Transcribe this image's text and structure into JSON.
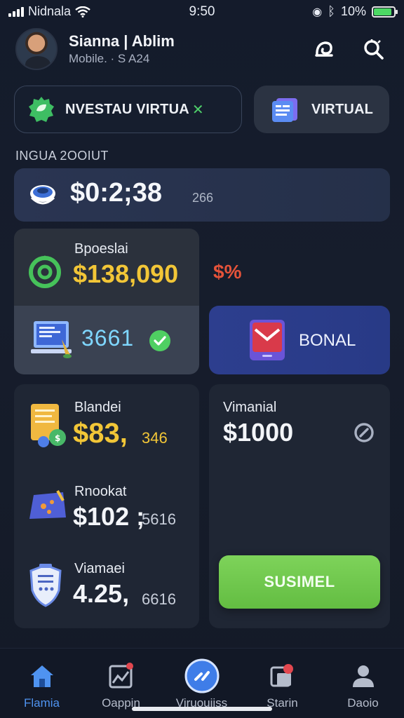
{
  "status": {
    "carrier": "Nidnala",
    "time": "9:50",
    "battery_percent": "10%",
    "battery_level": 0.9
  },
  "header": {
    "user_name": "Sianna | Ablim",
    "user_subtitle": "Mobile. · S A24"
  },
  "chips": {
    "invest_label": "NVESTAU VIRTUA",
    "virtual_label": "VIRTUAL"
  },
  "section_title": "INGUA 2OOIUT",
  "balance": {
    "value": "$0:2;38",
    "sub": "266"
  },
  "cards": {
    "personal": {
      "label": "Bpoeslai",
      "value": "$138,090",
      "change": "$%"
    },
    "virtual_box": {
      "value": "3661"
    },
    "bonal": {
      "label": "BONAL"
    },
    "blandei": {
      "label": "Blandei",
      "value": "$83,",
      "side": "346"
    },
    "rnookat": {
      "label": "Rnookat",
      "value": "$102 ;",
      "side": "5616"
    },
    "viamaei": {
      "label": "Viamaei",
      "value": "4.25,",
      "side": "6616"
    },
    "vimanial": {
      "label": "Vimanial",
      "value": "$1000"
    }
  },
  "submit_label": "SUSIMEL",
  "nav": [
    {
      "label": "Flamia",
      "icon": "home-icon",
      "active": true
    },
    {
      "label": "Oappin",
      "icon": "chart-icon",
      "active": false
    },
    {
      "label": "Viruouiiss",
      "icon": "swap-icon",
      "active": false
    },
    {
      "label": "Starin",
      "icon": "card-icon",
      "active": false
    },
    {
      "label": "Daoio",
      "icon": "profile-icon",
      "active": false
    }
  ],
  "colors": {
    "background": "#151c2b",
    "accent_blue": "#4f93f0",
    "accent_green": "#6cc64b",
    "accent_yellow": "#f2c637",
    "accent_red": "#e5533a",
    "bonal_card": "#2d3e8e"
  }
}
